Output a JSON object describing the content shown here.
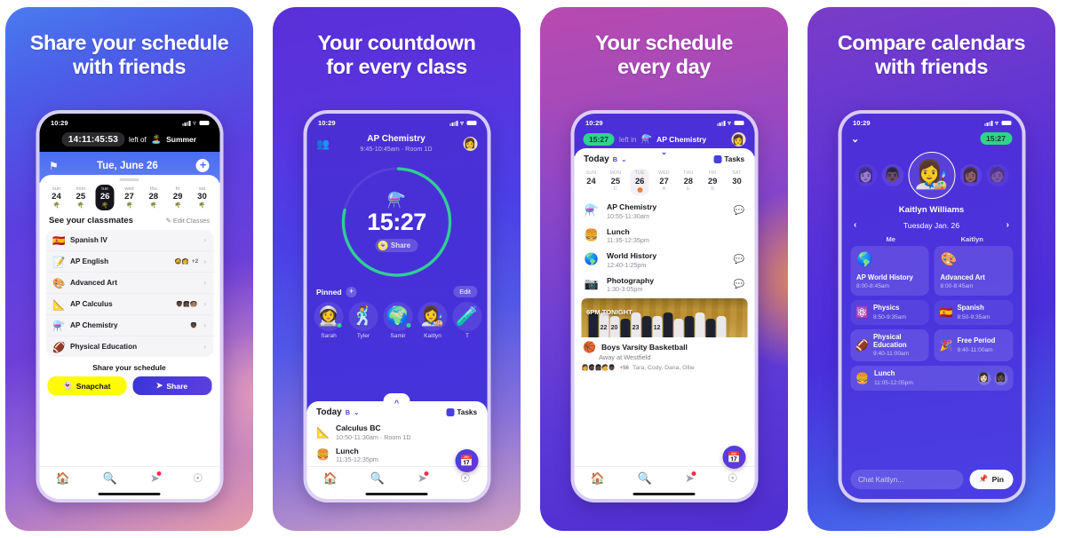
{
  "cards": [
    {
      "headline": "Share your schedule\nwith friends",
      "status": {
        "time": "10:29"
      },
      "countdown": {
        "value": "14:11:45:53",
        "label": "left of",
        "emoji": "🏝️",
        "target": "Summer"
      },
      "header": {
        "tag_icon": "tag-icon",
        "date": "Tue, June 26",
        "add_label": "+"
      },
      "week": [
        {
          "name": "sun",
          "num": "24",
          "icon": "🌴",
          "selected": false
        },
        {
          "name": "mon",
          "num": "25",
          "icon": "🌴",
          "selected": false
        },
        {
          "name": "tue",
          "num": "26",
          "icon": "🌴",
          "selected": true
        },
        {
          "name": "wed",
          "num": "27",
          "icon": "🌴",
          "selected": false
        },
        {
          "name": "thu",
          "num": "28",
          "icon": "🌴",
          "selected": false
        },
        {
          "name": "fri",
          "num": "29",
          "icon": "🌴",
          "selected": false
        },
        {
          "name": "sat",
          "num": "30",
          "icon": "🌴",
          "selected": false
        }
      ],
      "section": {
        "title": "See your classmates",
        "edit": "✎ Edit Classes"
      },
      "classes": [
        {
          "emoji": "🇪🇸",
          "name": "Spanish IV",
          "faces": [],
          "extra": ""
        },
        {
          "emoji": "📝",
          "name": "AP English",
          "faces": [
            "🧔",
            "👩"
          ],
          "extra": "+2"
        },
        {
          "emoji": "🎨",
          "name": "Advanced Art",
          "faces": [],
          "extra": ""
        },
        {
          "emoji": "📐",
          "name": "AP Calculus",
          "faces": [
            "👨🏿",
            "👩🏿",
            "🧑🏽"
          ],
          "extra": ""
        },
        {
          "emoji": "⚗️",
          "name": "AP Chemistry",
          "faces": [
            "👨🏿"
          ],
          "extra": ""
        },
        {
          "emoji": "🏈",
          "name": "Physical Education",
          "faces": [],
          "extra": ""
        }
      ],
      "share_label": "Share your schedule",
      "buttons": {
        "snapchat": "Snapchat",
        "share": "Share"
      }
    },
    {
      "headline": "Your countdown\nfor every class",
      "status": {
        "time": "10:29"
      },
      "header": {
        "people_icon": "people-icon",
        "class": "AP Chemistry",
        "meta": "9:45-10:45am · Room 1D"
      },
      "ring": {
        "emoji": "⚗️",
        "time": "15:27",
        "share": "Share",
        "progress": 78
      },
      "pinned": {
        "label": "Pinned",
        "add": "+",
        "edit": "Edit"
      },
      "friends": [
        {
          "emoji": "👩‍🚀",
          "name": "Sarah",
          "online": true
        },
        {
          "emoji": "🕺",
          "name": "Tyler",
          "online": false
        },
        {
          "emoji": "🌍",
          "name": "Samir",
          "online": true
        },
        {
          "emoji": "👩‍🎨",
          "name": "Kaitlyn",
          "online": false
        },
        {
          "emoji": "🧪",
          "name": "T",
          "online": false
        }
      ],
      "today": {
        "label": "Today",
        "letter": "B",
        "tasks": "Tasks"
      },
      "events": [
        {
          "emoji": "📐",
          "name": "Calculus BC",
          "time": "10:50-11:30am · Room 1D"
        },
        {
          "emoji": "🍔",
          "name": "Lunch",
          "time": "11:35-12:35pm"
        }
      ]
    },
    {
      "headline": "Your schedule\nevery day",
      "status": {
        "time": "10:29"
      },
      "header": {
        "pill": "15:27",
        "left_in": "left in",
        "emoji": "⚗️",
        "class": "AP Chemistry"
      },
      "today": {
        "label": "Today",
        "letter": "B",
        "tasks": "Tasks"
      },
      "week": [
        {
          "name": "SUN",
          "num": "24",
          "letter": "-"
        },
        {
          "name": "MON",
          "num": "25",
          "letter": "C"
        },
        {
          "name": "TUE",
          "num": "26",
          "letter": "",
          "selected": true
        },
        {
          "name": "WED",
          "num": "27",
          "letter": "A"
        },
        {
          "name": "THU",
          "num": "28",
          "letter": "E"
        },
        {
          "name": "FRI",
          "num": "29",
          "letter": "B"
        },
        {
          "name": "SAT",
          "num": "30",
          "letter": "-"
        }
      ],
      "events": [
        {
          "emoji": "⚗️",
          "name": "AP Chemistry",
          "time": "10:55-11:30am",
          "bubble": true,
          "ring": true
        },
        {
          "emoji": "🍔",
          "name": "Lunch",
          "time": "11:35-12:35pm",
          "bubble": false
        },
        {
          "emoji": "🌎",
          "name": "World History",
          "time": "12:40-1:25pm",
          "bubble": true
        },
        {
          "emoji": "📷",
          "name": "Photography",
          "time": "1:30-3:05pm",
          "bubble": true
        }
      ],
      "promo": {
        "overlay": "6PM TONIGHT",
        "jersey_numbers": [
          "22",
          "20",
          "23",
          "12"
        ],
        "emoji": "🏀",
        "title": "Boys Varsity Basketball",
        "subtitle": "Away at Westfield",
        "faces": [
          "👩",
          "🧔🏿",
          "👩🏿",
          "🧑",
          "👨🏿"
        ],
        "count": "+56",
        "names": "Tara, Cody, Dana, Ollie"
      }
    },
    {
      "headline": "Compare calendars\nwith friends",
      "status": {
        "time": "10:29"
      },
      "header": {
        "collapse_icon": "chevron-down-icon",
        "pill": "15:27"
      },
      "avatars": [
        "👩🏻",
        "👨🏿",
        "👩🏾",
        "🧑🏽"
      ],
      "main_avatar": "👩‍🎨",
      "username": "Kaitlyn Williams",
      "datenav": {
        "prev": "‹",
        "date": "Tuesday Jan. 26",
        "next": "›"
      },
      "columns": [
        "Me",
        "Kaitlyn"
      ],
      "rows": [
        {
          "style": "big",
          "left": {
            "emoji": "🌎",
            "name": "AP World History",
            "time": "8:00-8:45am"
          },
          "right": {
            "emoji": "🎨",
            "name": "Advanced Art",
            "time": "8:00-8:45am"
          }
        },
        {
          "style": "inline-dim",
          "left": {
            "emoji": "⚛️",
            "name": "Physics",
            "time": "8:50-9:35am"
          },
          "right": {
            "emoji": "🇪🇸",
            "name": "Spanish",
            "time": "8:50-9:35am"
          }
        },
        {
          "style": "inline",
          "left": {
            "emoji": "🏈",
            "name": "Physical Education",
            "time": "9:40-11:00am"
          },
          "right": {
            "emoji": "🎉",
            "name": "Free Period",
            "time": "9:40-11:00am"
          }
        }
      ],
      "lunch": {
        "emoji": "🍔",
        "name": "Lunch",
        "time": "11:05-12:05pm",
        "faces": [
          "👩🏻",
          "👩🏿"
        ]
      },
      "bottom": {
        "chat_placeholder": "Chat Kaitlyn...",
        "pin_label": "Pin",
        "pin_icon": "pin-icon"
      }
    }
  ],
  "nav": {
    "home": "home-icon",
    "search": "search-icon",
    "send": "send-icon",
    "profile": "profile-icon"
  },
  "colors": {
    "snapchat_yellow": "#FFFC00",
    "accent_purple": "#4A3FE0",
    "green": "#2FD38D",
    "orange": "#F0803C"
  }
}
